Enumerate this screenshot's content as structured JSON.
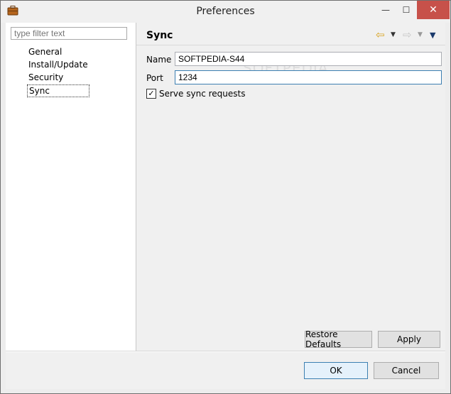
{
  "window": {
    "title": "Preferences",
    "minimize_glyph": "—",
    "maximize_glyph": "☐",
    "close_glyph": "✕"
  },
  "sidebar": {
    "filter_placeholder": "type filter text",
    "items": [
      {
        "label": "General"
      },
      {
        "label": "Install/Update"
      },
      {
        "label": "Security"
      },
      {
        "label": "Sync",
        "selected": true
      }
    ]
  },
  "page": {
    "title": "Sync",
    "nav": {
      "back_icon": "arrow-left-icon",
      "forward_icon": "arrow-right-icon",
      "menu_icon": "view-menu-icon"
    },
    "fields": {
      "name_label": "Name",
      "name_value": "SOFTPEDIA-S44",
      "port_label": "Port",
      "port_value": "1234"
    },
    "serve_sync_label": "Serve sync requests",
    "serve_sync_checked": true,
    "watermark": "SOFTPEDIA",
    "restore_defaults_label": "Restore Defaults",
    "apply_label": "Apply"
  },
  "footer": {
    "ok_label": "OK",
    "cancel_label": "Cancel"
  },
  "colors": {
    "close_button": "#c7514a",
    "focus_border": "#3c7fb1",
    "back_arrow": "#d8a21e"
  }
}
